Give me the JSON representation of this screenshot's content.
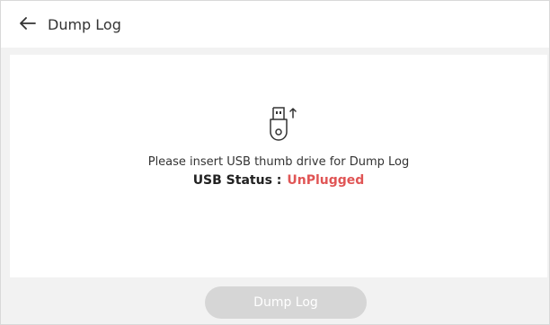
{
  "header": {
    "title": "Dump Log"
  },
  "content": {
    "icon": "usb-thumb-drive-icon",
    "message": "Please insert USB thumb drive for Dump Log",
    "status_label": "USB Status :",
    "status_value": "UnPlugged",
    "status_color": "#e05555"
  },
  "footer": {
    "button_label": "Dump Log",
    "button_enabled": false
  }
}
